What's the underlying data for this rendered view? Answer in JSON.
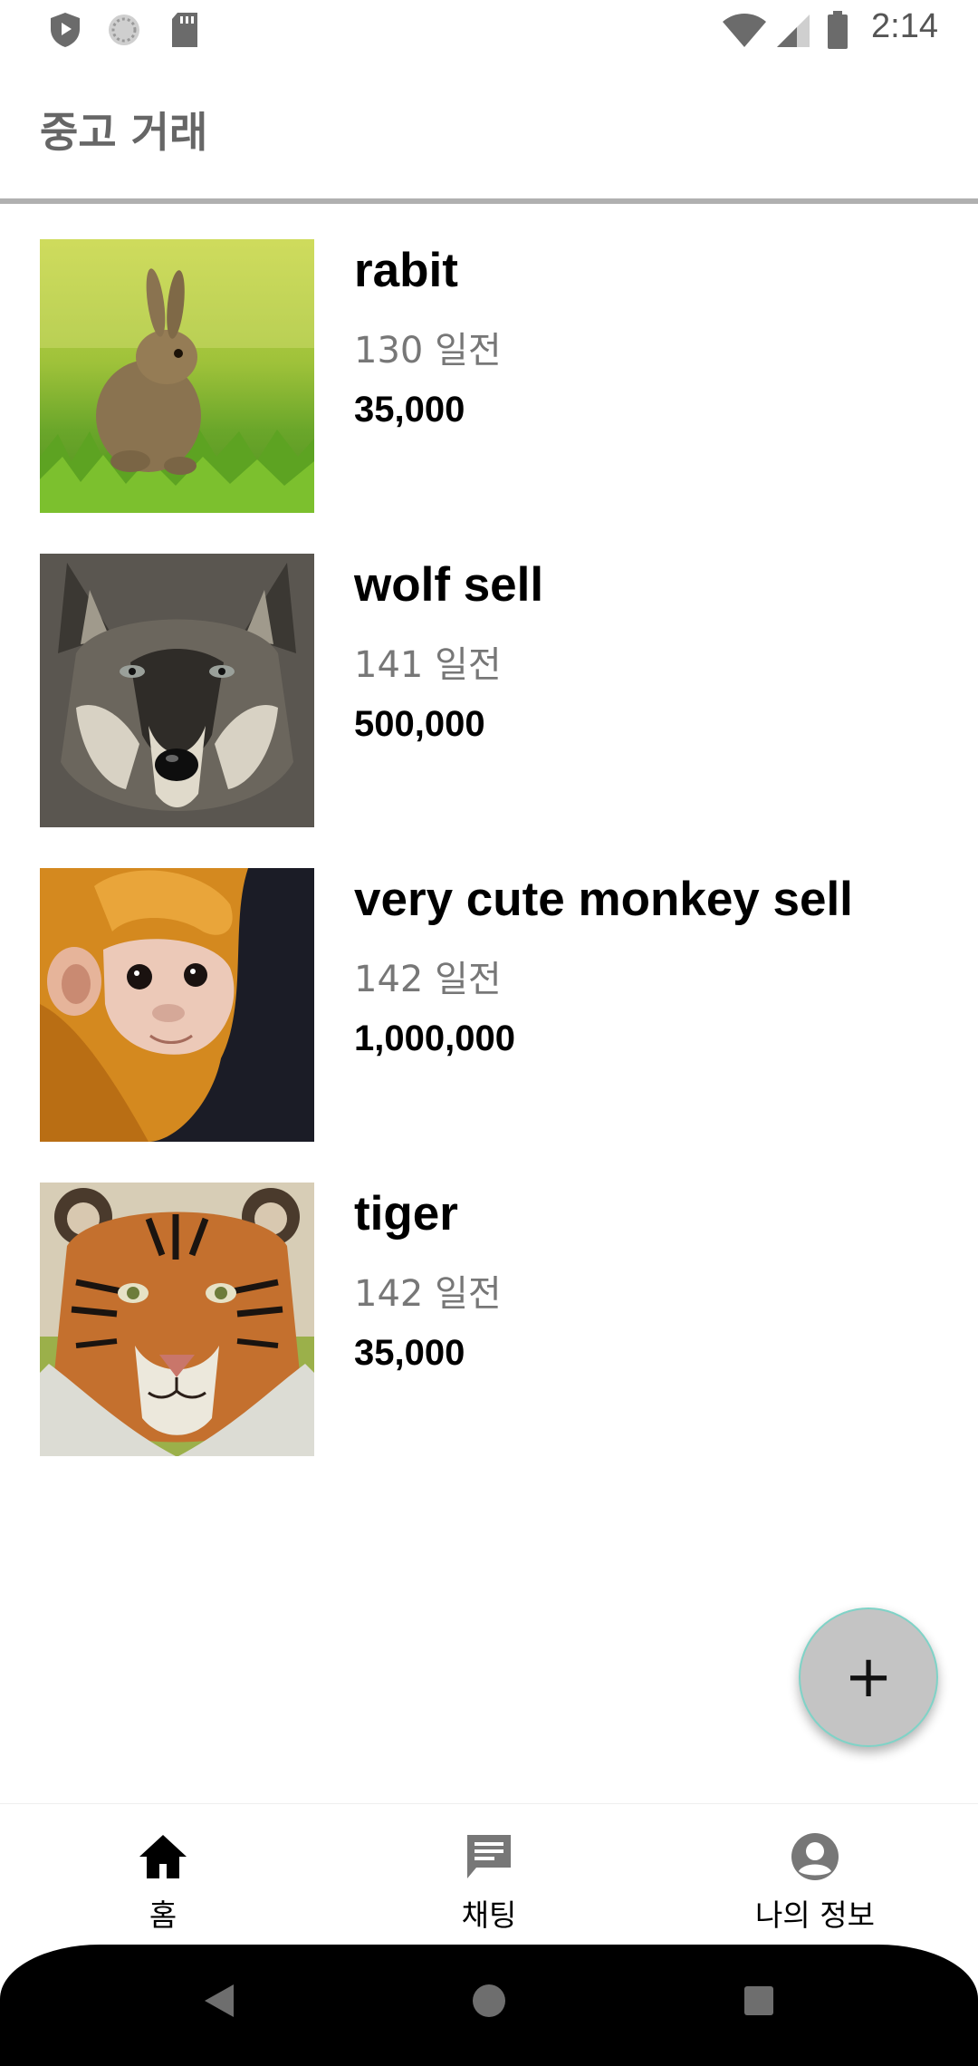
{
  "status_bar": {
    "time": "2:14",
    "icons": [
      "shield-icon",
      "sync-icon",
      "sd-card-icon",
      "wifi-icon",
      "signal-icon",
      "battery-icon"
    ]
  },
  "app_bar": {
    "title": "중고 거래"
  },
  "items": [
    {
      "title": "rabit",
      "date": "130 일전",
      "price": "35,000",
      "image": "rabbit-photo"
    },
    {
      "title": "wolf sell",
      "date": "141 일전",
      "price": "500,000",
      "image": "wolf-photo"
    },
    {
      "title": "very cute monkey sell",
      "date": "142 일전",
      "price": "1,000,000",
      "image": "monkey-photo"
    },
    {
      "title": "tiger",
      "date": "142 일전",
      "price": "35,000",
      "image": "tiger-photo"
    }
  ],
  "fab": {
    "icon": "plus-icon",
    "label": "+"
  },
  "bottom_nav": [
    {
      "label": "홈",
      "icon": "home-icon",
      "active": true
    },
    {
      "label": "채팅",
      "icon": "chat-icon",
      "active": false
    },
    {
      "label": "나의 정보",
      "icon": "account-icon",
      "active": false
    }
  ],
  "colors": {
    "background": "#ffffff",
    "title_gray": "#666666",
    "date_gray": "#777777",
    "fab": "#c4c4c4",
    "fab_border": "#7fd3c7",
    "active_nav": "#000000",
    "inactive_nav": "#777777"
  }
}
